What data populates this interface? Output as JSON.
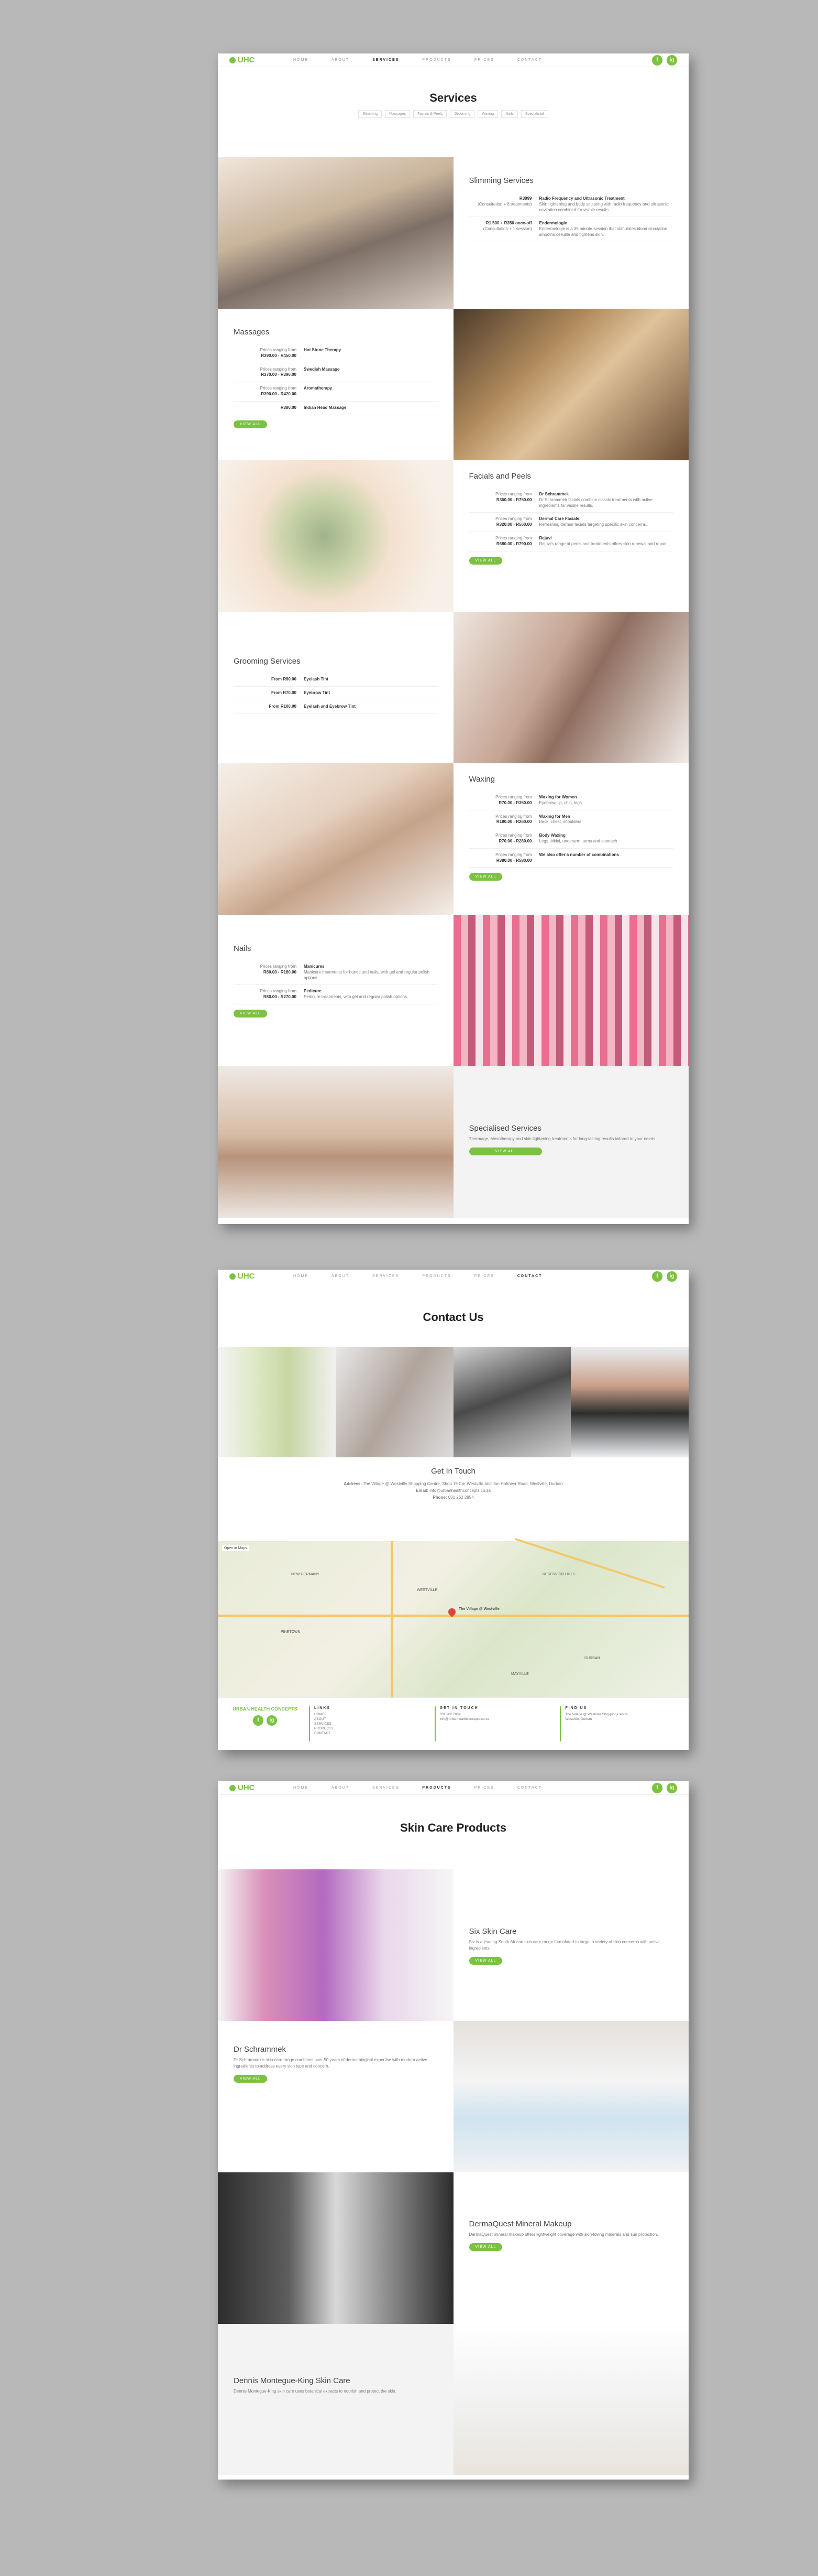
{
  "nav": {
    "logo": "UHC",
    "links": [
      "HOME",
      "ABOUT",
      "SERVICES",
      "PRODUCTS",
      "PRICES",
      "CONTACT"
    ],
    "social": [
      "f",
      "ig"
    ]
  },
  "services_page": {
    "title": "Services",
    "subnav": [
      "Slimming",
      "Massages",
      "Facials & Peels",
      "Grooming",
      "Waxing",
      "Nails",
      "Specialised"
    ],
    "slimming": {
      "title": "Slimming Services",
      "items": [
        {
          "price": "R3999",
          "price_sub": "(Consultation + 8 treatments)",
          "name": "Radio Frequency and Ultrasonic Treatment",
          "desc": "Skin tightening and body sculpting with radio frequency and ultrasonic cavitation combined for visible results."
        },
        {
          "price": "R1 500 + R350 once-off",
          "price_sub": "(Consultation + 1 session)",
          "name": "Endermologie",
          "desc": "Endermologie is a 35 minute session that stimulates blood circulation, smooths cellulite and tightens skin."
        }
      ]
    },
    "massages": {
      "title": "Massages",
      "items": [
        {
          "price_sub": "Prices ranging from",
          "price": "R390.00 - R450.00",
          "name": "Hot Stone Therapy"
        },
        {
          "price_sub": "Prices ranging from",
          "price": "R370.00 - R390.00",
          "name": "Swedish Massage"
        },
        {
          "price_sub": "Prices ranging from",
          "price": "R390.00 - R420.00",
          "name": "Aromatherapy"
        },
        {
          "price_sub": "",
          "price": "R380.00",
          "name": "Indian Head Massage"
        }
      ],
      "button": "VIEW ALL"
    },
    "facials": {
      "title": "Facials and Peels",
      "items": [
        {
          "price_sub": "Prices ranging from",
          "price": "R360.00 - R750.00",
          "name": "Dr Schrammek",
          "desc": "Dr Schrammek facials combine classic treatments with active ingredients for visible results."
        },
        {
          "price_sub": "Prices ranging from",
          "price": "R320.00 - R560.00",
          "name": "Dermal Care Facials",
          "desc": "Refreshing dermal facials targeting specific skin concerns."
        },
        {
          "price_sub": "Prices ranging from",
          "price": "R680.00 - R790.00",
          "name": "Rejuvi",
          "desc": "Rejuvi's range of peels and treatments offers skin renewal and repair."
        }
      ],
      "button": "VIEW ALL"
    },
    "grooming": {
      "title": "Grooming Services",
      "items": [
        {
          "price": "From R80.00",
          "name": "Eyelash Tint"
        },
        {
          "price": "From R70.00",
          "name": "Eyebrow Tint"
        },
        {
          "price": "From R100.00",
          "name": "Eyelash and Eyebrow Tint"
        }
      ]
    },
    "waxing": {
      "title": "Waxing",
      "items": [
        {
          "price_sub": "Prices ranging from",
          "price": "R70.00 - R350.00",
          "name": "Waxing for Women",
          "desc": "Eyebrow, lip, chin, legs"
        },
        {
          "price_sub": "Prices ranging from",
          "price": "R180.00 - R260.00",
          "name": "Waxing for Men",
          "desc": "Back, chest, shoulders"
        },
        {
          "price_sub": "Prices ranging from",
          "price": "R70.00 - R280.00",
          "name": "Body Waxing",
          "desc": "Legs, bikini, underarm, arms and stomach"
        },
        {
          "price_sub": "Prices ranging from",
          "price": "R380.00 - R580.00",
          "name": "We also offer a number of combinations",
          "desc": ""
        }
      ],
      "button": "VIEW ALL"
    },
    "nails": {
      "title": "Nails",
      "items": [
        {
          "price_sub": "Prices ranging from",
          "price": "R80.00 - R180.00",
          "name": "Manicures",
          "desc": "Manicure treatments for hands and nails, with gel and regular polish options."
        },
        {
          "price_sub": "Prices ranging from",
          "price": "R80.00 - R270.00",
          "name": "Pedicure",
          "desc": "Pedicure treatments, with gel and regular polish options."
        }
      ],
      "button": "VIEW ALL"
    },
    "specialised": {
      "title": "Specialised Services",
      "desc": "Thermage, Mesotherapy and skin tightening treatments for long-lasting results tailored to your needs.",
      "button": "VIEW ALL"
    }
  },
  "contact_page": {
    "title": "Contact Us",
    "touch_title": "Get In Touch",
    "address_label": "Address:",
    "address": "The Village @ Westville Shopping Centre, Shop 19 Cnr Westville and Jan Hofmeyr Road, Westville, Durban",
    "email_label": "Email:",
    "email": "info@urbanhealthconcepts.co.za",
    "phone_label": "Phone:",
    "phone": "031 262 2854",
    "map_tag": "Open in Maps",
    "map_pin": "The Village @ Westville",
    "map_places": [
      "WESTVILLE",
      "PINETOWN",
      "NEW GERMANY",
      "RESERVOIR HILLS",
      "DURBAN",
      "MAYVILLE"
    ],
    "footer_logo": "URBAN HEALTH CONCEPTS",
    "footer": [
      {
        "title": "LINKS",
        "lines": [
          "HOME",
          "ABOUT",
          "SERVICES",
          "PRODUCTS",
          "CONTACT"
        ]
      },
      {
        "title": "GET IN TOUCH",
        "lines": [
          "031 262 2854",
          "info@urbanhealthconcepts.co.za"
        ]
      },
      {
        "title": "FIND US",
        "lines": [
          "The Village @ Westville Shopping Centre",
          "Westville, Durban"
        ]
      }
    ]
  },
  "products_page": {
    "title": "Skin Care Products",
    "six": {
      "title": "Six Skin Care",
      "desc": "Six is a leading South African skin care range formulated to target a variety of skin concerns with active ingredients.",
      "button": "VIEW ALL"
    },
    "schrammek": {
      "title": "Dr Schrammek",
      "desc": "Dr Schrammek's skin care range combines over 50 years of dermatological expertise with modern active ingredients to address every skin type and concern.",
      "button": "VIEW ALL"
    },
    "dermaquest": {
      "title": "DermaQuest Mineral Makeup",
      "desc": "DermaQuest mineral makeup offers lightweight coverage with skin-loving minerals and sun protection.",
      "button": "VIEW ALL"
    },
    "dennis": {
      "title": "Dennis Montegue-King Skin Care",
      "desc": "Dennis Montegue-King skin care uses botanical extracts to nourish and protect the skin."
    }
  }
}
